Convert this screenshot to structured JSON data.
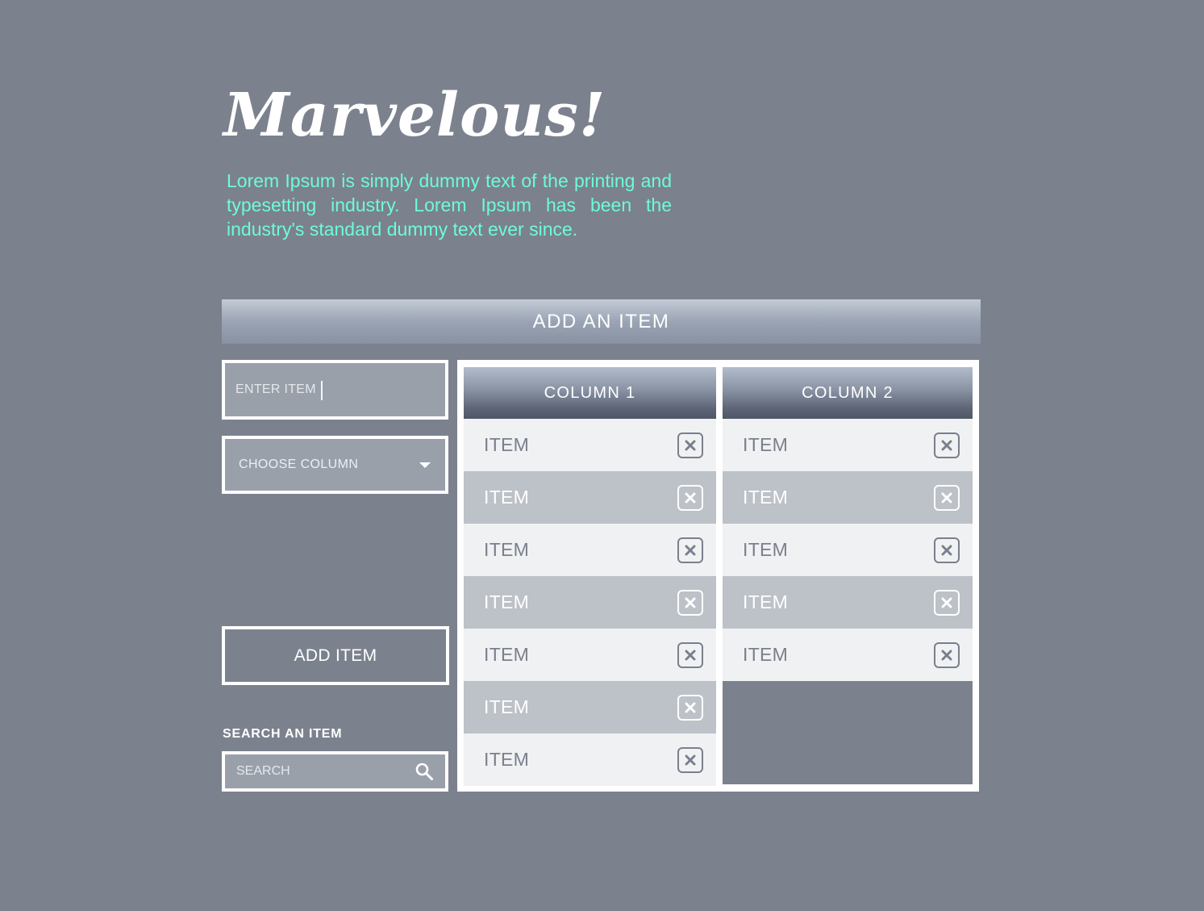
{
  "hero": {
    "title": "Marvelous!",
    "description": "Lorem Ipsum is simply dummy text of the printing and typesetting industry. Lorem Ipsum has been the industry's standard dummy text ever since."
  },
  "banner": {
    "label": "ADD AN ITEM"
  },
  "form": {
    "enter_placeholder": "ENTER ITEM",
    "choose_label": "CHOOSE COLUMN",
    "add_button": "ADD ITEM",
    "search_label": "SEARCH AN ITEM",
    "search_placeholder": "SEARCH"
  },
  "columns": [
    {
      "title": "COLUMN 1",
      "items": [
        "ITEM",
        "ITEM",
        "ITEM",
        "ITEM",
        "ITEM",
        "ITEM",
        "ITEM"
      ]
    },
    {
      "title": "COLUMN 2",
      "items": [
        "ITEM",
        "ITEM",
        "ITEM",
        "ITEM",
        "ITEM"
      ]
    }
  ],
  "icons": {
    "remove": "close-icon",
    "search": "search-icon",
    "dropdown": "chevron-down-icon"
  },
  "colors": {
    "background": "#7c818e",
    "accent_text": "#6dfbd7",
    "row_light": "#f0f1f3",
    "row_dark": "#bdc1c8"
  }
}
